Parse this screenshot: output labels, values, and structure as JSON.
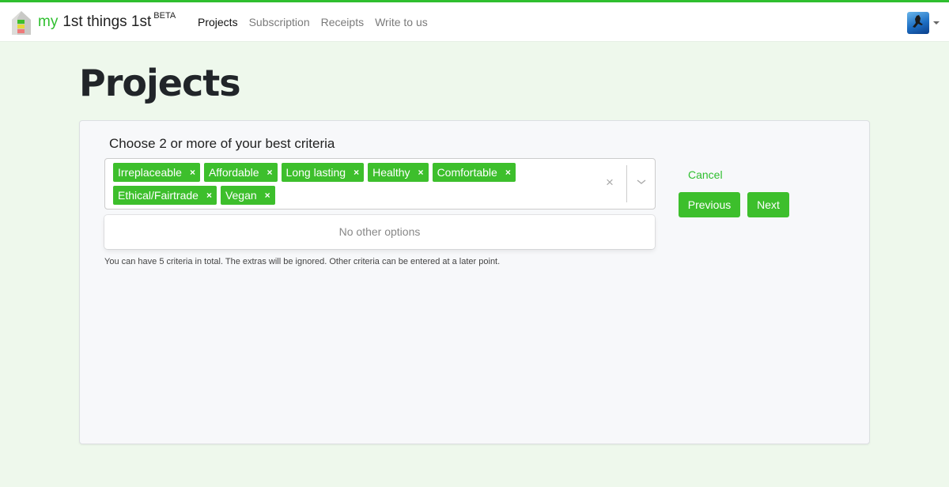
{
  "app": {
    "brand_my": "my",
    "brand_name": "1st things 1st",
    "brand_badge": "BETA",
    "accent_color": "#2fbf2f"
  },
  "nav": {
    "items": [
      {
        "label": "Projects",
        "active": true
      },
      {
        "label": "Subscription",
        "active": false
      },
      {
        "label": "Receipts",
        "active": false
      },
      {
        "label": "Write to us",
        "active": false
      }
    ]
  },
  "user": {
    "avatar_icon": "user-avatar",
    "menu_icon": "caret-down-icon"
  },
  "page": {
    "title": "Projects"
  },
  "criteria_form": {
    "label": "Choose 2 or more of your best criteria",
    "selected": [
      "Irreplaceable",
      "Affordable",
      "Long lasting",
      "Healthy",
      "Comfortable",
      "Ethical/Fairtrade",
      "Vegan"
    ],
    "remove_glyph": "×",
    "clear_glyph": "×",
    "menu_message": "No other options",
    "hint": "You can have 5 criteria in total. The extras will be ignored. Other criteria can be entered at a later point."
  },
  "actions": {
    "cancel": "Cancel",
    "previous": "Previous",
    "next": "Next"
  }
}
